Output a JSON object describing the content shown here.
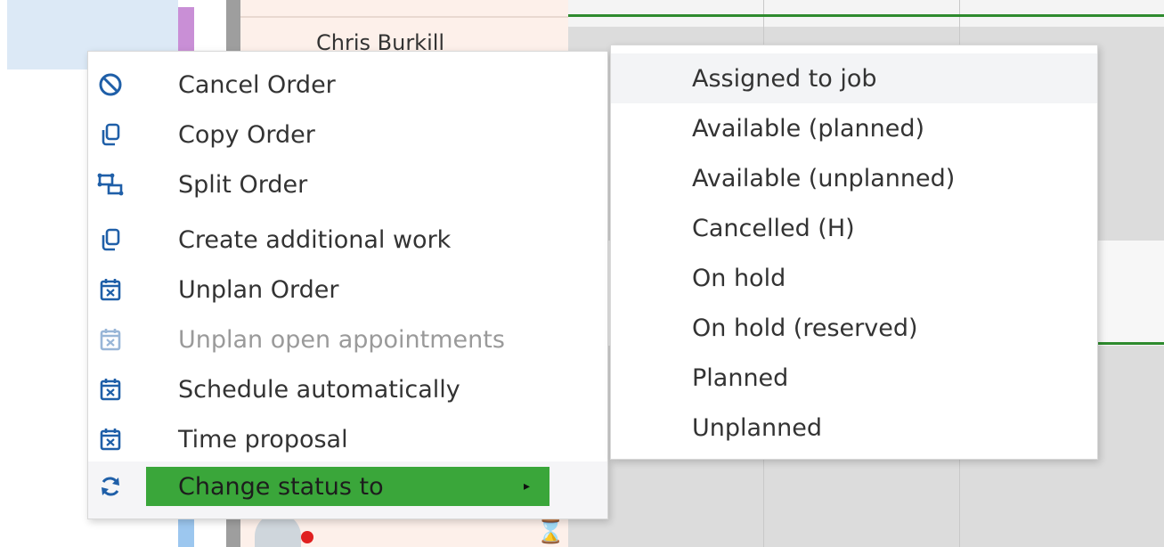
{
  "background": {
    "name_fragment": "Chris Burkill"
  },
  "context_menu": {
    "items": [
      {
        "label": "Cancel Order",
        "icon": "cancel-icon",
        "enabled": true
      },
      {
        "label": "Copy Order",
        "icon": "copy-icon",
        "enabled": true
      },
      {
        "label": "Split Order",
        "icon": "split-icon",
        "enabled": true
      },
      {
        "label": "Create additional work",
        "icon": "copy-icon",
        "enabled": true
      },
      {
        "label": "Unplan Order",
        "icon": "calendar-x-icon",
        "enabled": true
      },
      {
        "label": "Unplan open appointments",
        "icon": "calendar-x-icon",
        "enabled": false
      },
      {
        "label": "Schedule automatically",
        "icon": "calendar-x-icon",
        "enabled": true
      },
      {
        "label": "Time proposal",
        "icon": "calendar-x-icon",
        "enabled": true
      }
    ],
    "change_status": {
      "label": "Change status to",
      "icon": "refresh-icon",
      "arrow": "▸"
    }
  },
  "status_submenu": {
    "items": [
      "Assigned to job",
      "Available (planned)",
      "Available (unplanned)",
      "Cancelled (H)",
      "On hold",
      "On hold (reserved)",
      "Planned",
      "Unplanned"
    ],
    "hovered_index": 0
  },
  "colors": {
    "icon_blue": "#1f5fa8",
    "highlight_green": "#3aa63a",
    "schedule_green": "#2e8b2e"
  }
}
